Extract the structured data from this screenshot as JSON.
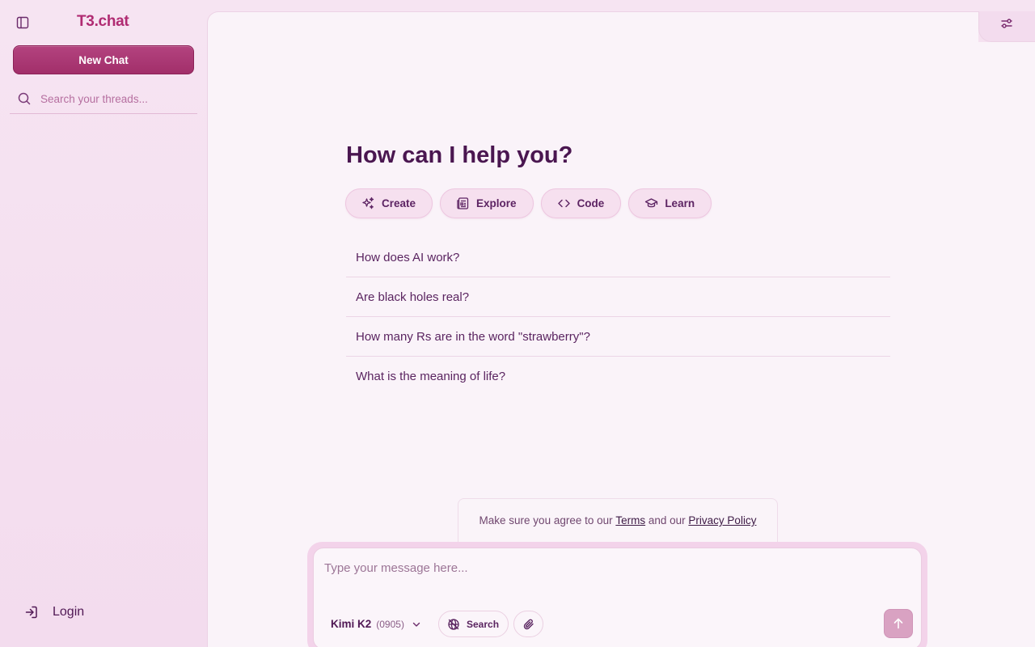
{
  "app": {
    "logo": "T3.chat"
  },
  "sidebar": {
    "new_chat_label": "New Chat",
    "search_placeholder": "Search your threads...",
    "login_label": "Login"
  },
  "main": {
    "heading": "How can I help you?",
    "categories": [
      {
        "label": "Create",
        "icon": "sparkles-icon"
      },
      {
        "label": "Explore",
        "icon": "newspaper-icon"
      },
      {
        "label": "Code",
        "icon": "code-icon"
      },
      {
        "label": "Learn",
        "icon": "graduation-cap-icon"
      }
    ],
    "suggestions": [
      "How does AI work?",
      "Are black holes real?",
      "How many Rs are in the word \"strawberry\"?",
      "What is the meaning of life?"
    ]
  },
  "notice": {
    "prefix": "Make sure you agree to our ",
    "terms": "Terms",
    "middle": " and our ",
    "privacy": "Privacy Policy"
  },
  "composer": {
    "placeholder": "Type your message here...",
    "model_name": "Kimi K2",
    "model_version": "(0905)",
    "search_label": "Search"
  },
  "colors": {
    "accent": "#b02b72",
    "button": "#a22f6a",
    "text": "#501854",
    "send": "#d9a2c2"
  }
}
